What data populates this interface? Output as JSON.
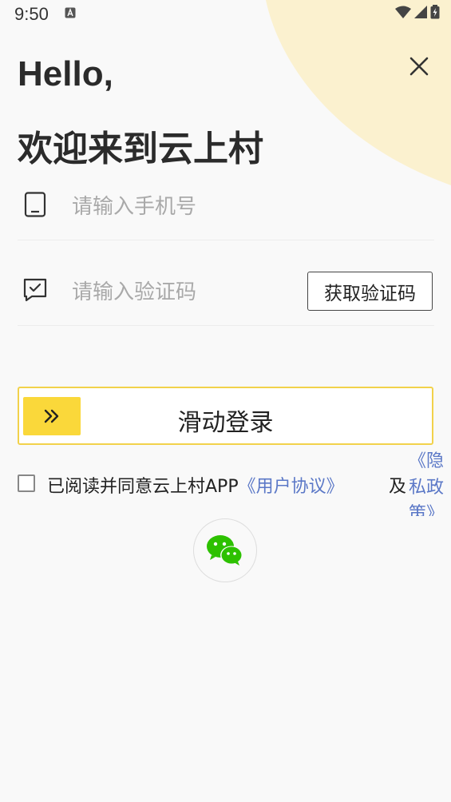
{
  "status_bar": {
    "time": "9:50"
  },
  "header": {
    "greeting": "Hello,",
    "welcome": "欢迎来到云上村"
  },
  "form": {
    "phone": {
      "placeholder": "请输入手机号",
      "value": ""
    },
    "code": {
      "placeholder": "请输入验证码",
      "value": "",
      "get_code_label": "获取验证码"
    }
  },
  "slider": {
    "label": "滑动登录",
    "progress": 0
  },
  "agreement": {
    "checked": false,
    "prefix": "已阅读并同意云上村APP",
    "user_agreement": "《用户协议》",
    "and": "及",
    "privacy_policy": "《隐私政策》"
  },
  "icons": {
    "close": "close-icon",
    "phone": "phone-icon",
    "code": "message-check-icon",
    "slider": "double-chevron-right-icon",
    "wechat": "wechat-icon"
  },
  "colors": {
    "accent_yellow": "#fad83a",
    "slider_border": "#f2d24b",
    "link_blue": "#5b78c7",
    "blob": "#fbf1cf",
    "wechat_green": "#2dc100"
  }
}
